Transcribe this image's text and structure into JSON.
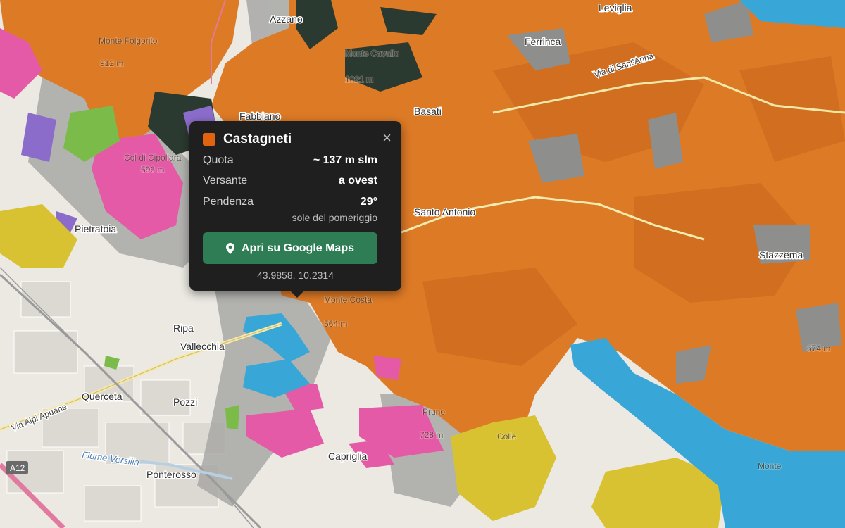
{
  "map": {
    "places": [
      "Azzano",
      "Leviglia",
      "Ferrinca",
      "Monte Folgorito",
      "912 m",
      "Monte Cavallo",
      "1021 m",
      "Fabbiano",
      "Basati",
      "Col di Cipollara",
      "596 m",
      "Pietratoia",
      "Santo Antonio",
      "Stazzema",
      "Monte Costa",
      "564 m",
      "Ripa",
      "Vallecchia",
      "Querceta",
      "Pozzi",
      "Ponterosso",
      "Capriglia",
      "Colle",
      "728 m",
      "Pruno",
      "Monte",
      "674 m"
    ],
    "river": "Fiume Versilia",
    "roads": [
      "Via Alpi Apuane",
      "A12",
      "Via di Sant'Anna"
    ],
    "legend_colors": {
      "castagneti": "#e07a22",
      "faggete": "#c9661b",
      "arbusteti": "#d9c43a",
      "prati": "#3aaad6",
      "rocce": "#e85aa8",
      "coltivi": "#7ab648",
      "boschi_misti": "#8a6bc7"
    }
  },
  "popup": {
    "swatch_color": "#e0640f",
    "title": "Castagneti",
    "close": "×",
    "rows": [
      {
        "label": "Quota",
        "value": "~ 137 m slm"
      },
      {
        "label": "Versante",
        "value": "a ovest"
      },
      {
        "label": "Pendenza",
        "value": "29°"
      }
    ],
    "note": "sole del pomeriggio",
    "button_label": "Apri su Google Maps",
    "button_icon": "map-pin-icon",
    "coords": "43.9858, 10.2314"
  }
}
